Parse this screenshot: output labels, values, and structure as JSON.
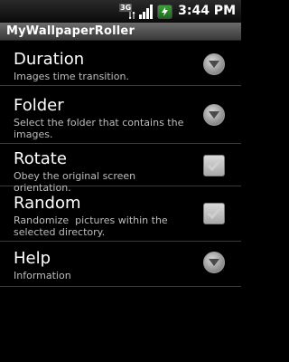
{
  "status_bar": {
    "network_label": "3G",
    "time": "3:44 PM",
    "icons": [
      "3g-data-icon",
      "signal-strength-icon",
      "battery-charging-icon"
    ]
  },
  "app": {
    "title": "MyWallpaperRoller"
  },
  "preferences": [
    {
      "title": "Duration",
      "summary": "Images time transition.",
      "control": "dropdown"
    },
    {
      "title": "Folder",
      "summary": "Select the folder that contains the images.",
      "control": "dropdown"
    },
    {
      "title": "Rotate",
      "summary": "Obey the original screen orientation.",
      "control": "checkbox",
      "checked": true
    },
    {
      "title": "Random",
      "summary": "Randomize  pictures within the selected directory.",
      "control": "checkbox",
      "checked": true
    },
    {
      "title": "Help",
      "summary": "Information",
      "control": "dropdown"
    }
  ],
  "colors": {
    "background": "#000000",
    "title_bar": "#5a5a5a",
    "summary_text": "#bdbdbd",
    "battery": "#2e8b2e"
  }
}
